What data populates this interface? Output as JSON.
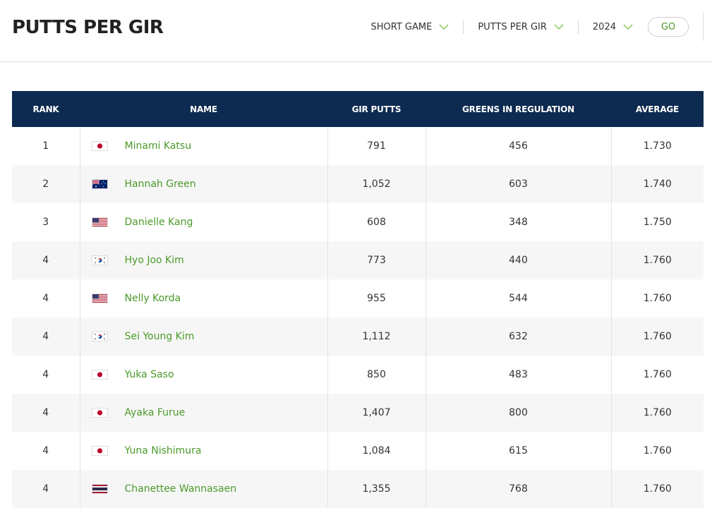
{
  "page": {
    "title": "PUTTS PER GIR"
  },
  "filters": {
    "category": "SHORT GAME",
    "stat": "PUTTS PER GIR",
    "year": "2024",
    "go_label": "GO"
  },
  "table": {
    "headers": [
      "RANK",
      "NAME",
      "GIR PUTTS",
      "GREENS IN REGULATION",
      "AVERAGE"
    ],
    "rows": [
      {
        "rank": "1",
        "flag": "jpn",
        "name": "Minami Katsu",
        "gir_putts": "791",
        "gir": "456",
        "average": "1.730"
      },
      {
        "rank": "2",
        "flag": "aus",
        "name": "Hannah Green",
        "gir_putts": "1,052",
        "gir": "603",
        "average": "1.740"
      },
      {
        "rank": "3",
        "flag": "usa",
        "name": "Danielle Kang",
        "gir_putts": "608",
        "gir": "348",
        "average": "1.750"
      },
      {
        "rank": "4",
        "flag": "kor",
        "name": "Hyo Joo Kim",
        "gir_putts": "773",
        "gir": "440",
        "average": "1.760"
      },
      {
        "rank": "4",
        "flag": "usa",
        "name": "Nelly Korda",
        "gir_putts": "955",
        "gir": "544",
        "average": "1.760"
      },
      {
        "rank": "4",
        "flag": "kor",
        "name": "Sei Young Kim",
        "gir_putts": "1,112",
        "gir": "632",
        "average": "1.760"
      },
      {
        "rank": "4",
        "flag": "jpn",
        "name": "Yuka Saso",
        "gir_putts": "850",
        "gir": "483",
        "average": "1.760"
      },
      {
        "rank": "4",
        "flag": "jpn",
        "name": "Ayaka Furue",
        "gir_putts": "1,407",
        "gir": "800",
        "average": "1.760"
      },
      {
        "rank": "4",
        "flag": "jpn",
        "name": "Yuna Nishimura",
        "gir_putts": "1,084",
        "gir": "615",
        "average": "1.760"
      },
      {
        "rank": "4",
        "flag": "tha",
        "name": "Chanettee Wannasaen",
        "gir_putts": "1,355",
        "gir": "768",
        "average": "1.760"
      }
    ]
  },
  "colors": {
    "header_bg": "#0d2a50",
    "link": "#4a9a2a",
    "stripe": "#f6f6f6"
  }
}
